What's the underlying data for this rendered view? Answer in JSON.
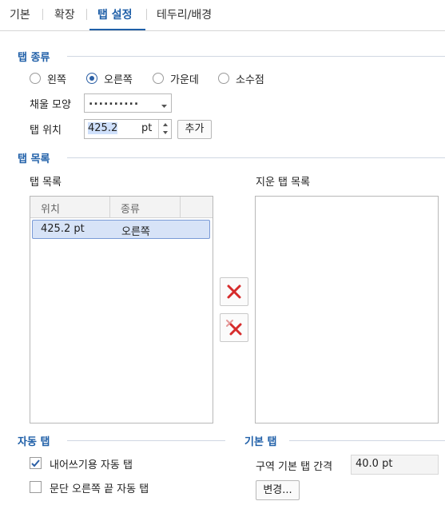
{
  "tabs": [
    {
      "label": "기본"
    },
    {
      "label": "확장"
    },
    {
      "label": "탭 설정"
    },
    {
      "label": "테두리/배경"
    }
  ],
  "tab_kind": {
    "title": "탭 종류",
    "options": [
      {
        "label": "왼쪽",
        "checked": false
      },
      {
        "label": "오른쪽",
        "checked": true
      },
      {
        "label": "가운데",
        "checked": false
      },
      {
        "label": "소수점",
        "checked": false
      }
    ],
    "fill_label": "채울 모양",
    "fill_value": "..........",
    "position_label": "탭 위치",
    "position_value": "425.2",
    "position_unit": "pt",
    "add_button": "추가"
  },
  "tab_list": {
    "title": "탭 목록",
    "list_label": "탭 목록",
    "columns": [
      "위치",
      "종류"
    ],
    "rows": [
      {
        "position": "425.2 pt",
        "kind": "오른쪽"
      }
    ],
    "deleted_label": "지운 탭 목록",
    "delete_icon": "red-x-icon",
    "delete_all_icon": "red-x-all-icon"
  },
  "auto_tab": {
    "title": "자동 탭",
    "options": [
      {
        "label": "내어쓰기용 자동 탭",
        "checked": true
      },
      {
        "label": "문단 오른쪽 끝 자동 탭",
        "checked": false
      }
    ]
  },
  "default_tab": {
    "title": "기본 탭",
    "interval_label": "구역 기본 탭 간격",
    "interval_value": "40.0 pt",
    "change_button": "변경..."
  },
  "colors": {
    "accent": "#1f5fa8",
    "delete_red": "#d62b2b"
  }
}
